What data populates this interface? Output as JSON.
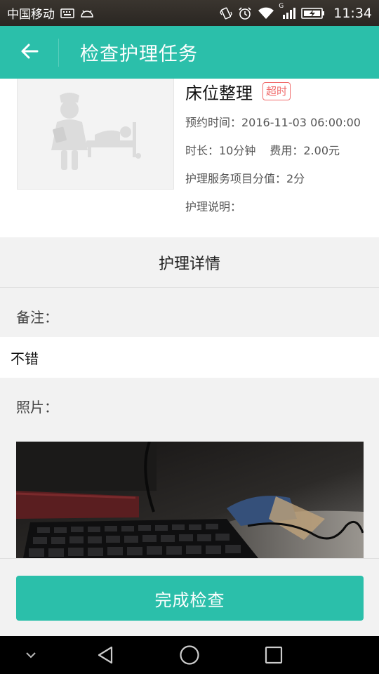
{
  "status_bar": {
    "carrier": "中国移动",
    "time": "11:34",
    "icons": [
      "keyboard-icon",
      "android-icon",
      "vibrate-icon",
      "alarm-icon",
      "wifi-icon",
      "signal-icon",
      "battery-icon"
    ],
    "network_type": "G"
  },
  "header": {
    "title": "检查护理任务",
    "back_icon": "arrow-left-icon"
  },
  "task": {
    "name": "床位整理",
    "badge": "超时",
    "appointment": "预约时间：2016-11-03 06:00:00",
    "duration": "时长：10分钟",
    "fee": "费用：2.00元",
    "score": "护理服务项目分值：2分",
    "description": "护理说明：",
    "thumbnail_icon": "nurse-bed-icon"
  },
  "details": {
    "section_title": "护理详情",
    "note_label": "备注：",
    "note_value": "不错",
    "photo_label": "照片："
  },
  "actions": {
    "complete_label": "完成检查"
  },
  "navbar": {
    "icons": [
      "chevron-down-icon",
      "back-triangle-icon",
      "home-circle-icon",
      "recents-square-icon"
    ]
  },
  "colors": {
    "accent": "#2bbfaa",
    "badge": "#f06b6b",
    "background": "#f2f2f2"
  }
}
